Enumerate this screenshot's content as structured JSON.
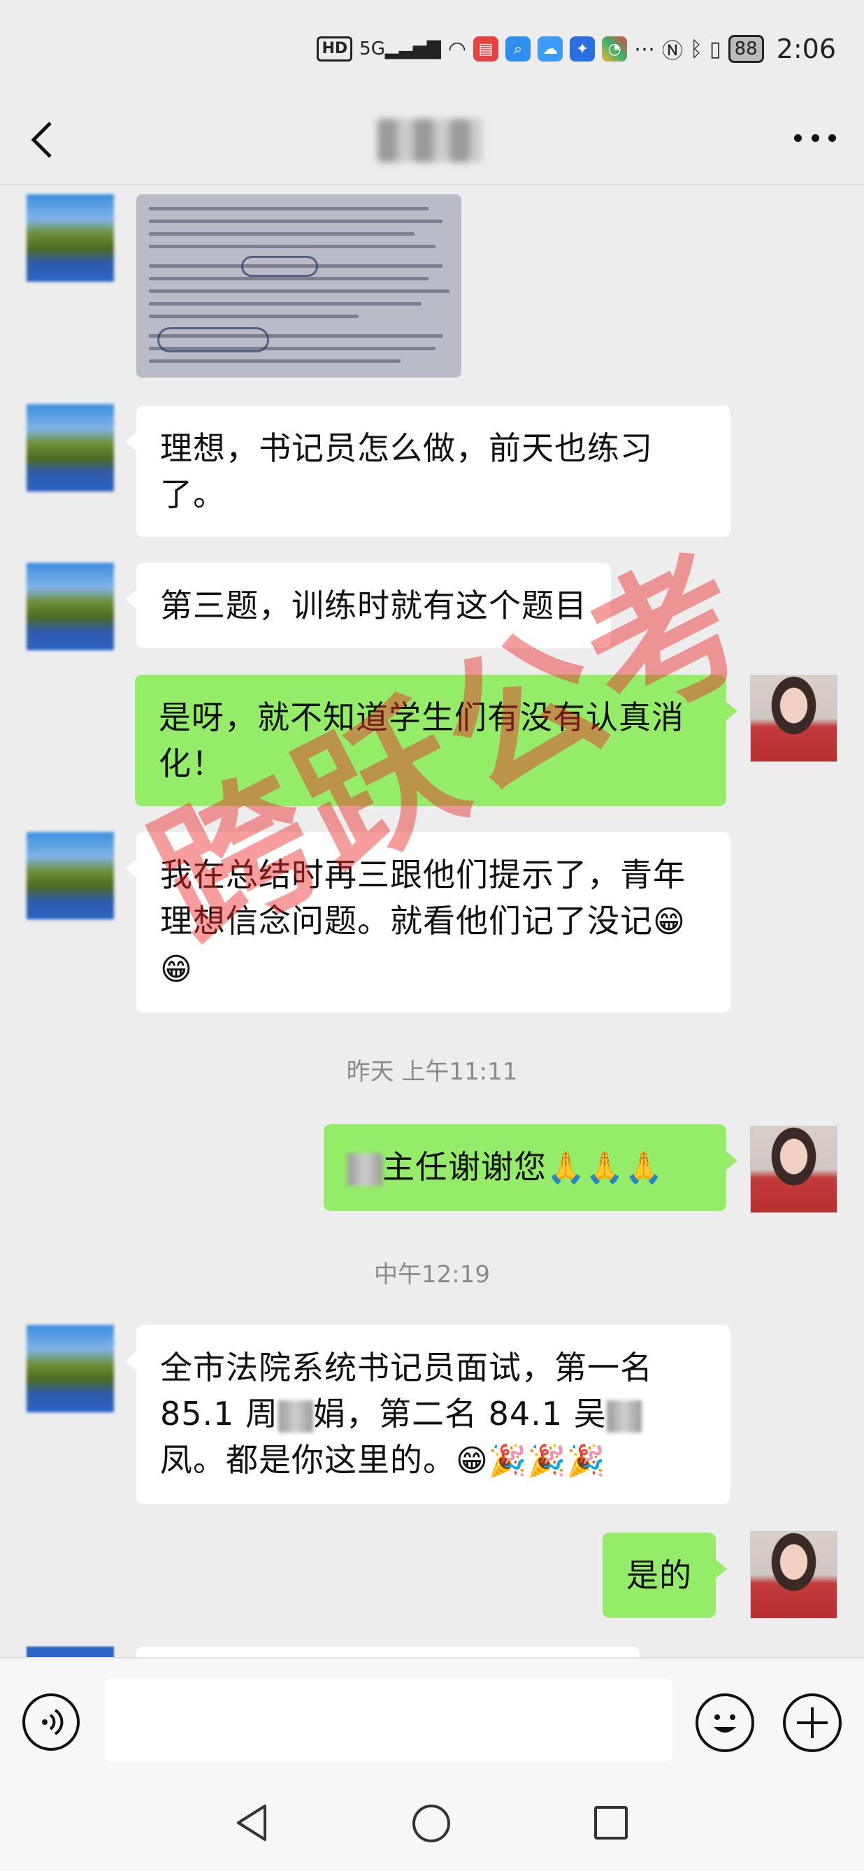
{
  "status_bar": {
    "hd": "HD",
    "network": "5G",
    "battery": "88",
    "time": "2:06"
  },
  "header": {
    "back_icon": "chevron-left-icon",
    "more_icon": "ellipsis-icon"
  },
  "messages": [
    {
      "id": "m2",
      "side": "left",
      "text": "理想，书记员怎么做，前天也练习了。"
    },
    {
      "id": "m3",
      "side": "left",
      "text": "第三题，训练时就有这个题目"
    },
    {
      "id": "m4",
      "side": "right",
      "text": "是呀，就不知道学生们有没有认真消化！"
    },
    {
      "id": "m5",
      "side": "left",
      "text": "我在总结时再三跟他们提示了，青年理想信念问题。就看他们记了没记",
      "emoji": "😁😁"
    },
    {
      "id": "m6",
      "side": "right",
      "text": "主任谢谢您",
      "emoji": "🙏🙏🙏"
    },
    {
      "id": "m7",
      "side": "left",
      "text_a": "全市法院系统书记员面试，第一名85.1 周",
      "text_b": "娟，第二名 84.1 吴",
      "text_c": "凤。都是你这里的。",
      "emoji": "😁🎉🎉🎉"
    },
    {
      "id": "m8",
      "side": "right",
      "text": "是的"
    }
  ],
  "timestamps": {
    "t1": "昨天 上午11:11",
    "t2": "中午12:19"
  },
  "watermark": "跨跃公考",
  "input_bar": {
    "voice_icon": "voice-icon",
    "emoji_icon": "smiley-icon",
    "plus_icon": "plus-icon",
    "placeholder": ""
  },
  "system_nav": {
    "back": "triangle-back-icon",
    "home": "circle-home-icon",
    "recent": "square-recents-icon"
  }
}
